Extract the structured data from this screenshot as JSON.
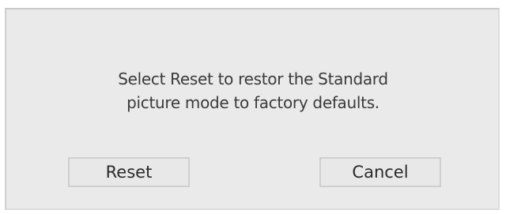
{
  "dialog": {
    "message_line1": "Select Reset to restor the Standard",
    "message_line2": "picture mode to factory defaults.",
    "reset_label": "Reset",
    "cancel_label": "Cancel"
  },
  "colors": {
    "dialog_background": "#eaeaea",
    "text": "#3a3a3a",
    "button_border": "#cfcfcf"
  }
}
